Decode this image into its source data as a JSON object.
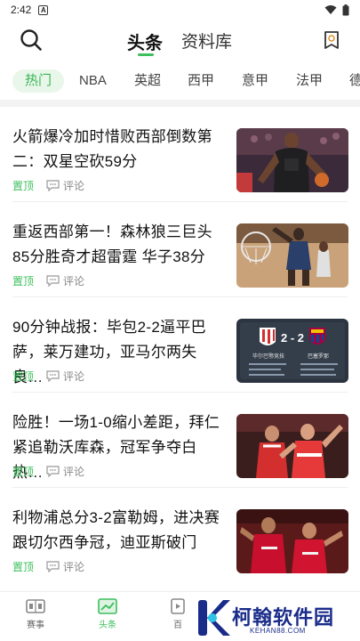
{
  "status_bar": {
    "time": "2:42",
    "notification_letter": "A"
  },
  "top_nav": {
    "tabs": [
      {
        "label": "头条",
        "active": true
      },
      {
        "label": "资料库",
        "active": false
      }
    ]
  },
  "categories": [
    {
      "label": "热门",
      "active": true
    },
    {
      "label": "NBA"
    },
    {
      "label": "英超"
    },
    {
      "label": "西甲"
    },
    {
      "label": "意甲"
    },
    {
      "label": "法甲"
    },
    {
      "label": "德"
    }
  ],
  "news": [
    {
      "title": "火箭爆冷加时惜败西部倒数第二：双星空砍59分",
      "pin": "置顶",
      "comment": "评论",
      "thumb": "basketball-rockets-photo"
    },
    {
      "title": "重返西部第一！森林狼三巨头85分胜奇才超雷霆 华子38分",
      "pin": "置顶",
      "comment": "评论",
      "thumb": "basketball-dunk-photo"
    },
    {
      "title": "90分钟战报：毕包2-2逼平巴萨，莱万建功，亚马尔两失良…",
      "pin": "置顶",
      "comment": "评论",
      "thumb": "scoreboard-graphic",
      "scoreboard": {
        "score": "2 - 2",
        "home": "毕尔巴鄂竞技",
        "away": "巴塞罗那"
      }
    },
    {
      "title": "险胜！一场1-0缩小差距，拜仁紧追勒沃库森，冠军争夺白热…",
      "pin": "置顶",
      "comment": "评论",
      "thumb": "football-celebration-photo"
    },
    {
      "title": "利物浦总分3-2富勒姆，进决赛跟切尔西争冠，迪亚斯破门",
      "pin": "置顶",
      "comment": "评论",
      "thumb": "liverpool-celebration-photo"
    }
  ],
  "bottom_tabs": [
    {
      "label": "赛事",
      "icon": "scoreboard-icon"
    },
    {
      "label": "头条",
      "icon": "chart-icon",
      "active": true
    },
    {
      "label": "百",
      "icon": "video-icon"
    }
  ],
  "watermark": {
    "text": "柯翰软件园",
    "url": "KEHAN88.COM"
  },
  "colors": {
    "accent": "#3cbf5c",
    "accent_bg": "#e9f7ea",
    "watermark": "#1a2c8a"
  }
}
